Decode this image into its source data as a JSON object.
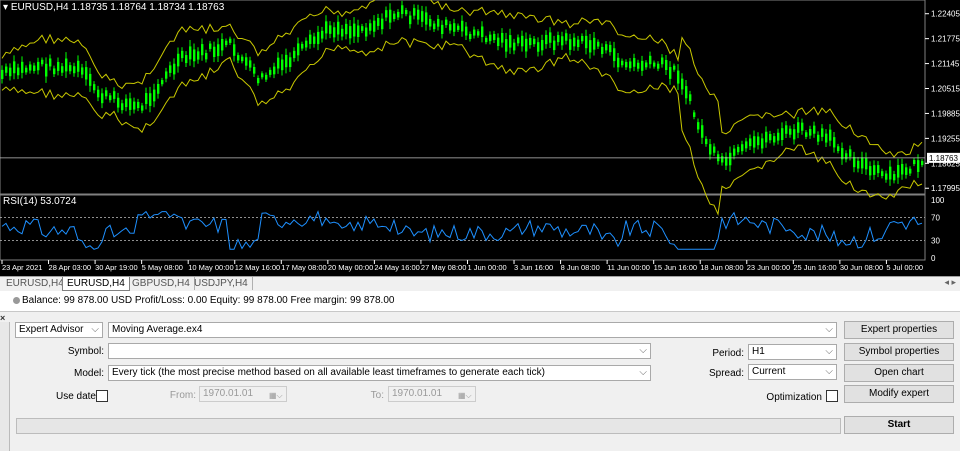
{
  "chart": {
    "title": "EURUSD,H4  1.18735 1.18764 1.18734 1.18763",
    "current_price": "1.18763",
    "price_ticks": [
      "1.22405",
      "1.21775",
      "1.21145",
      "1.20515",
      "1.19885",
      "1.19255",
      "1.18625",
      "1.17995"
    ],
    "rsi_title": "RSI(14) 53.0724",
    "rsi_ticks": [
      "100",
      "70",
      "30",
      "0"
    ],
    "time_ticks": [
      "23 Apr 2021",
      "28 Apr 03:00",
      "30 Apr 19:00",
      "5 May 08:00",
      "10 May 00:00",
      "12 May 16:00",
      "17 May 08:00",
      "20 May 00:00",
      "24 May 16:00",
      "27 May 08:00",
      "1 Jun 00:00",
      "3 Jun 16:00",
      "8 Jun 08:00",
      "11 Jun 00:00",
      "15 Jun 16:00",
      "18 Jun 08:00",
      "23 Jun 00:00",
      "25 Jun 16:00",
      "30 Jun 08:00",
      "5 Jul 00:00"
    ],
    "colors": {
      "background": "#000000",
      "candle": "#00ff00",
      "bands": "#c8c800",
      "rsi": "#1e90ff",
      "level": "#c0c0c0"
    }
  },
  "tabs": [
    "EURUSD,H4",
    "EURUSD,H4",
    "GBPUSD,H4",
    "USDJPY,H4"
  ],
  "active_tab": 1,
  "status": {
    "text": "Balance: 99 878.00 USD  Profit/Loss: 0.00  Equity: 99 878.00  Free margin: 99 878.00"
  },
  "tester": {
    "type_select": "Expert Advisor",
    "expert_file": "Moving Average.ex4",
    "symbol_label": "Symbol:",
    "symbol_value": "",
    "model_label": "Model:",
    "model_value": "Every tick (the most precise method based on all available least timeframes to generate each tick)",
    "use_date_label": "Use date",
    "from_label": "From:",
    "from_value": "1970.01.01",
    "to_label": "To:",
    "to_value": "1970.01.01",
    "period_label": "Period:",
    "period_value": "H1",
    "spread_label": "Spread:",
    "spread_value": "Current",
    "optimization_label": "Optimization",
    "buttons": {
      "expert_properties": "Expert properties",
      "symbol_properties": "Symbol properties",
      "open_chart": "Open chart",
      "modify_expert": "Modify expert",
      "start": "Start"
    }
  }
}
